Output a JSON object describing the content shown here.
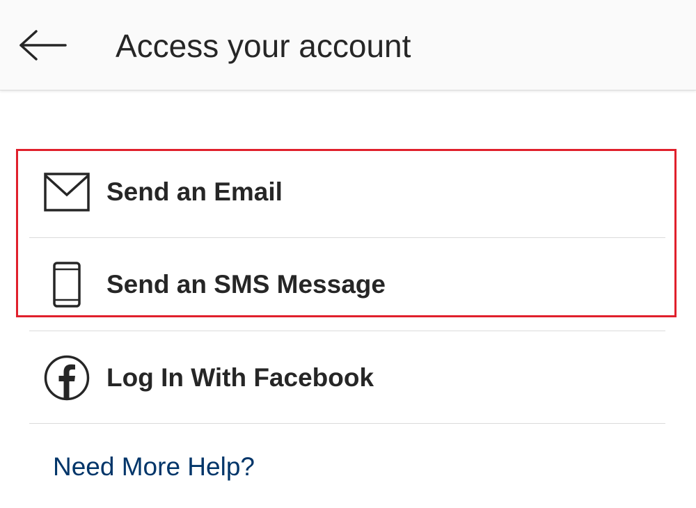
{
  "header": {
    "title": "Access your account",
    "back_icon": "arrow-left-icon"
  },
  "options": [
    {
      "label": "Send an Email",
      "icon": "envelope-icon"
    },
    {
      "label": "Send an SMS Message",
      "icon": "phone-icon"
    },
    {
      "label": "Log In With Facebook",
      "icon": "facebook-icon"
    }
  ],
  "help": {
    "label": "Need More Help?"
  },
  "colors": {
    "text": "#262626",
    "link": "#003569",
    "highlight": "#e0202c",
    "divider": "#dbdbdb",
    "header_bg": "#fafafa"
  }
}
